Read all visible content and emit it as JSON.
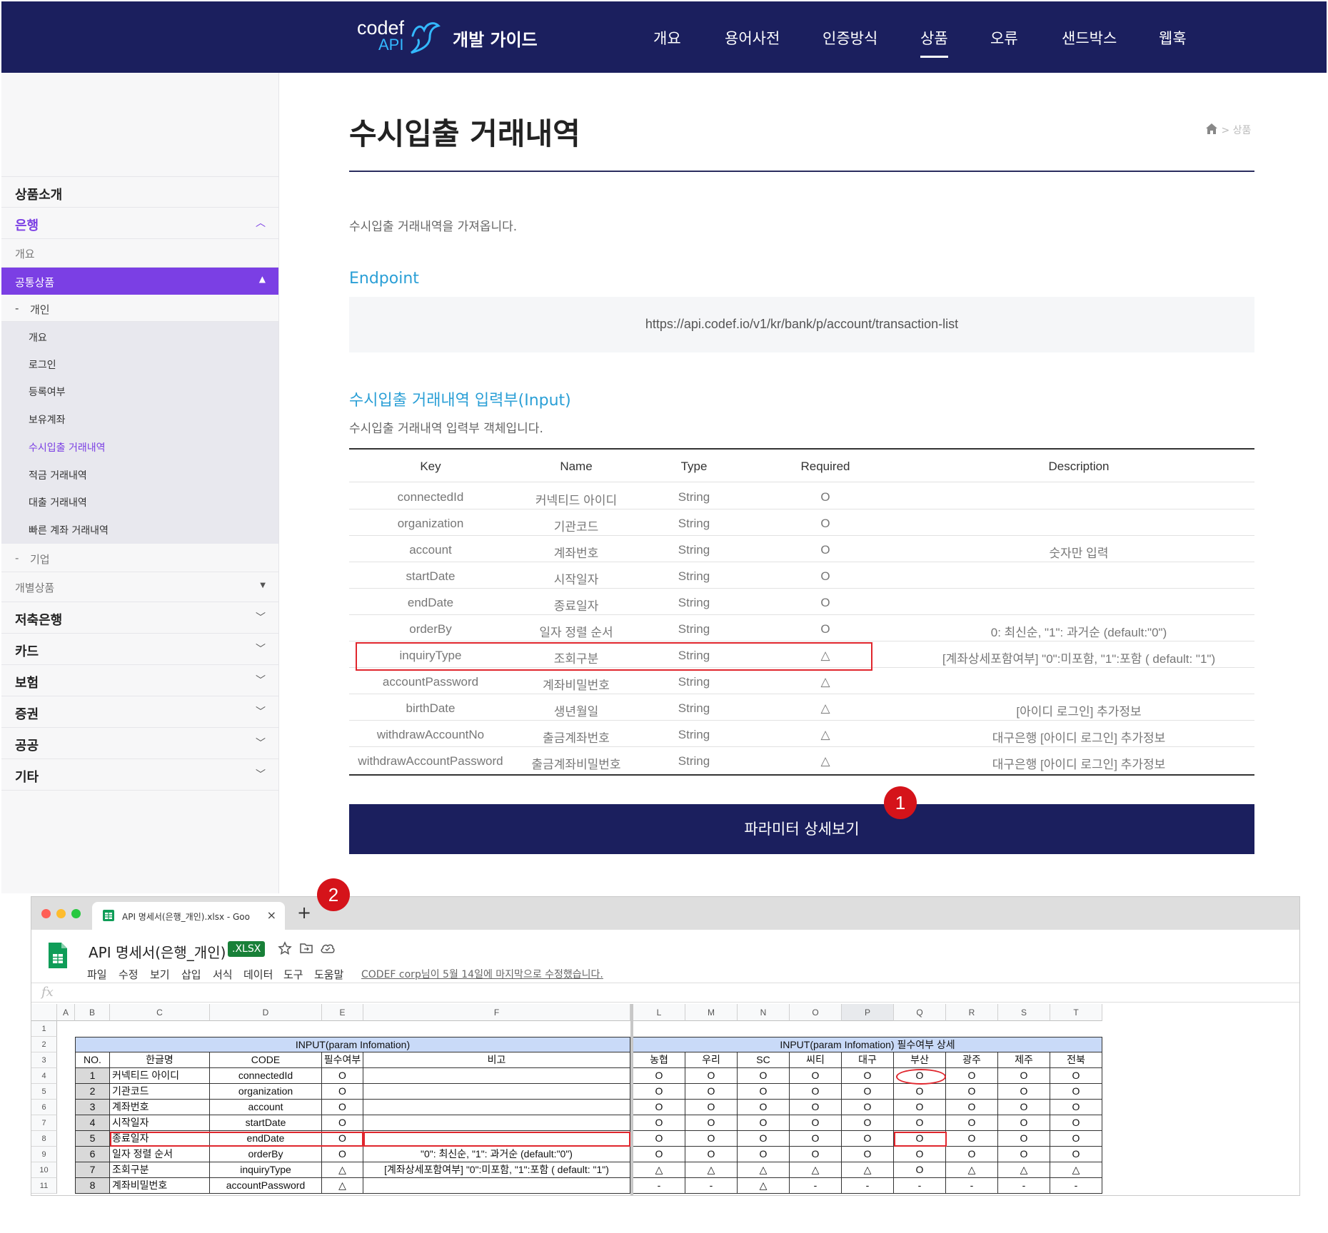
{
  "topnav": {
    "logo_line1": "codef",
    "logo_line2": "API",
    "brand": "개발 가이드",
    "items": [
      "개요",
      "용어사전",
      "인증방식",
      "상품",
      "오류",
      "샌드박스",
      "웹훅"
    ],
    "active": "상품"
  },
  "sidebar": {
    "product_intro": "상품소개",
    "bank": "은행",
    "bank_overview": "개요",
    "common_products": "공통상품",
    "personal": "개인",
    "personal_items": [
      "개요",
      "로그인",
      "등록여부",
      "보유계좌",
      "수시입출 거래내역",
      "적금 거래내역",
      "대출 거래내역",
      "빠른 계좌 거래내역"
    ],
    "personal_active": "수시입출 거래내역",
    "corporate": "기업",
    "individual_products": "개별상품",
    "categories": [
      "저축은행",
      "카드",
      "보험",
      "증권",
      "공공",
      "기타"
    ],
    "prefix_dash": "-"
  },
  "page": {
    "title": "수시입출 거래내역",
    "breadcrumb": "> 상품",
    "description": "수시입출 거래내역을 가져옵니다.",
    "endpoint_title": "Endpoint",
    "endpoint_url": "https://api.codef.io/v1/kr/bank/p/account/transaction-list",
    "input_title": "수시입출 거래내역 입력부(Input)",
    "input_desc": "수시입출 거래내역 입력부 객체입니다.",
    "detail_button": "파라미터 상세보기"
  },
  "param_table": {
    "headers": [
      "Key",
      "Name",
      "Type",
      "Required",
      "Description"
    ],
    "rows": [
      [
        "connectedId",
        "커넥티드 아이디",
        "String",
        "O",
        ""
      ],
      [
        "organization",
        "기관코드",
        "String",
        "O",
        ""
      ],
      [
        "account",
        "계좌번호",
        "String",
        "O",
        "숫자만 입력"
      ],
      [
        "startDate",
        "시작일자",
        "String",
        "O",
        ""
      ],
      [
        "endDate",
        "종료일자",
        "String",
        "O",
        ""
      ],
      [
        "orderBy",
        "일자 정렬 순서",
        "String",
        "O",
        "0: 최신순, \"1\": 과거순 (default:\"0\")"
      ],
      [
        "inquiryType",
        "조회구분",
        "String",
        "△",
        "[계좌상세포함여부] \"0\":미포함, \"1\":포함 ( default: \"1\")"
      ],
      [
        "accountPassword",
        "계좌비밀번호",
        "String",
        "△",
        ""
      ],
      [
        "birthDate",
        "생년월일",
        "String",
        "△",
        "[아이디 로그인] 추가정보"
      ],
      [
        "withdrawAccountNo",
        "출금계좌번호",
        "String",
        "△",
        "대구은행 [아이디 로그인] 추가정보"
      ],
      [
        "withdrawAccountPassword",
        "출금계좌비밀번호",
        "String",
        "△",
        "대구은행 [아이디 로그인] 추가정보"
      ]
    ]
  },
  "badges": [
    "1",
    "2"
  ],
  "spreadsheet": {
    "tab_title": "API 명세서(은행_개인).xlsx - Goo",
    "tab_close": "×",
    "new_tab": "+",
    "doc_title": "API 명세서(은행_개인)",
    "file_badge": ".XLSX",
    "menus": [
      "파일",
      "수정",
      "보기",
      "삽입",
      "서식",
      "데이터",
      "도구",
      "도움말"
    ],
    "last_edit": "CODEF corp님이 5월 14일에 마지막으로 수정했습니다.",
    "fx": "fx",
    "col_letters_left": [
      "A",
      "B",
      "C",
      "D",
      "E",
      "F"
    ],
    "col_letters_right": [
      "L",
      "M",
      "N",
      "O",
      "P",
      "Q",
      "R",
      "S",
      "T"
    ],
    "selected_col": "P",
    "row_numbers": [
      "1",
      "2",
      "3",
      "4",
      "5",
      "6",
      "7",
      "8",
      "9",
      "10",
      "11"
    ],
    "left_header": "INPUT(param Infomation)",
    "right_header": "INPUT(param Infomation) 필수여부 상세",
    "left_cols": [
      "NO.",
      "한글명",
      "CODE",
      "필수여부",
      "비고"
    ],
    "banks": [
      "농협",
      "우리",
      "SC",
      "씨티",
      "대구",
      "부산",
      "광주",
      "제주",
      "전북"
    ],
    "rows": [
      {
        "no": "1",
        "kor": "커넥티드 아이디",
        "code": "connectedId",
        "req": "O",
        "note": "",
        "banks": [
          "O",
          "O",
          "O",
          "O",
          "O",
          "O",
          "O",
          "O",
          "O"
        ]
      },
      {
        "no": "2",
        "kor": "기관코드",
        "code": "organization",
        "req": "O",
        "note": "",
        "banks": [
          "O",
          "O",
          "O",
          "O",
          "O",
          "O",
          "O",
          "O",
          "O"
        ]
      },
      {
        "no": "3",
        "kor": "계좌번호",
        "code": "account",
        "req": "O",
        "note": "",
        "banks": [
          "O",
          "O",
          "O",
          "O",
          "O",
          "O",
          "O",
          "O",
          "O"
        ]
      },
      {
        "no": "4",
        "kor": "시작일자",
        "code": "startDate",
        "req": "O",
        "note": "",
        "banks": [
          "O",
          "O",
          "O",
          "O",
          "O",
          "O",
          "O",
          "O",
          "O"
        ]
      },
      {
        "no": "5",
        "kor": "종료일자",
        "code": "endDate",
        "req": "O",
        "note": "",
        "banks": [
          "O",
          "O",
          "O",
          "O",
          "O",
          "O",
          "O",
          "O",
          "O"
        ]
      },
      {
        "no": "6",
        "kor": "일자 정렬 순서",
        "code": "orderBy",
        "req": "O",
        "note": "\"0\": 최신순, \"1\": 과거순 (default:\"0\")",
        "banks": [
          "O",
          "O",
          "O",
          "O",
          "O",
          "O",
          "O",
          "O",
          "O"
        ]
      },
      {
        "no": "7",
        "kor": "조회구분",
        "code": "inquiryType",
        "req": "△",
        "note": "[계좌상세포함여부] \"0\":미포함, \"1\":포함 ( default: \"1\")",
        "banks": [
          "△",
          "△",
          "△",
          "△",
          "△",
          "O",
          "△",
          "△",
          "△"
        ]
      },
      {
        "no": "8",
        "kor": "계좌비밀번호",
        "code": "accountPassword",
        "req": "△",
        "note": "",
        "banks": [
          "-",
          "-",
          "△",
          "-",
          "-",
          "-",
          "-",
          "-",
          "-"
        ]
      }
    ]
  },
  "colors": {
    "navy": "#1b1f5e",
    "purple": "#7b3fe4",
    "link_blue": "#2a9fd6",
    "highlight_red": "#e0262d",
    "sheet_header_blue": "#c9daf8"
  }
}
